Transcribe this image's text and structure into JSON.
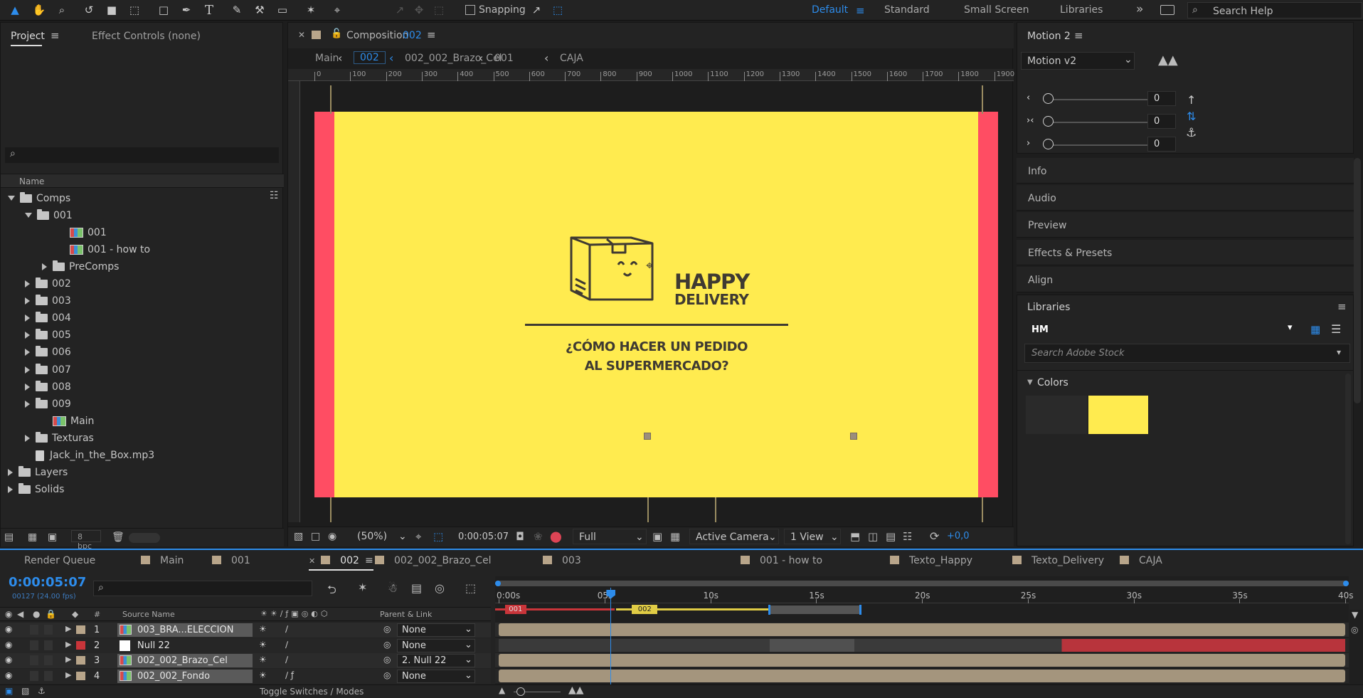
{
  "toolbar": {
    "snapping_label": "Snapping",
    "workspaces": [
      "Default",
      "Standard",
      "Small Screen",
      "Libraries"
    ],
    "search_placeholder": "Search Help",
    "accent": "#2d8ceb"
  },
  "project": {
    "tab_project": "Project",
    "tab_effect": "Effect Controls (none)",
    "column_name": "Name",
    "items": [
      {
        "label": "Comps",
        "type": "folder",
        "depth": 0,
        "expand": "open"
      },
      {
        "label": "001",
        "type": "folder",
        "depth": 1,
        "expand": "open"
      },
      {
        "label": "001",
        "type": "comp",
        "depth": 3,
        "expand": "none"
      },
      {
        "label": "001 - how to",
        "type": "comp",
        "depth": 3,
        "expand": "none"
      },
      {
        "label": "PreComps",
        "type": "folder",
        "depth": 2,
        "expand": "closed"
      },
      {
        "label": "002",
        "type": "folder",
        "depth": 1,
        "expand": "closed"
      },
      {
        "label": "003",
        "type": "folder",
        "depth": 1,
        "expand": "closed"
      },
      {
        "label": "004",
        "type": "folder",
        "depth": 1,
        "expand": "closed"
      },
      {
        "label": "005",
        "type": "folder",
        "depth": 1,
        "expand": "closed"
      },
      {
        "label": "006",
        "type": "folder",
        "depth": 1,
        "expand": "closed"
      },
      {
        "label": "007",
        "type": "folder",
        "depth": 1,
        "expand": "closed"
      },
      {
        "label": "008",
        "type": "folder",
        "depth": 1,
        "expand": "closed"
      },
      {
        "label": "009",
        "type": "folder",
        "depth": 1,
        "expand": "closed"
      },
      {
        "label": "Main",
        "type": "comp",
        "depth": 2,
        "expand": "none"
      },
      {
        "label": "Texturas",
        "type": "folder",
        "depth": 1,
        "expand": "closed"
      },
      {
        "label": "Jack_in_the_Box.mp3",
        "type": "audio",
        "depth": 1,
        "expand": "none"
      },
      {
        "label": "Layers",
        "type": "folder",
        "depth": 0,
        "expand": "closed"
      },
      {
        "label": "Solids",
        "type": "folder",
        "depth": 0,
        "expand": "closed"
      }
    ],
    "bpc": "8 bpc"
  },
  "composition": {
    "tab_prefix": "Composition",
    "tab_name": "002",
    "breadcrumbs": [
      "Main",
      "002",
      "002_002_Brazo_Cel",
      "001",
      "CAJA"
    ],
    "ruler_ticks": [
      "0",
      "100",
      "200",
      "300",
      "400",
      "500",
      "600",
      "700",
      "800",
      "900",
      "1000",
      "1100",
      "1200",
      "1300",
      "1400",
      "1500",
      "1600",
      "1700",
      "1800",
      "1900"
    ],
    "brand_line1": "HAPPY",
    "brand_line2": "DELIVERY",
    "question_line1": "¿CÓMO HACER UN PEDIDO",
    "question_line2": "AL SUPERMERCADO?",
    "bg_color": "#ffeb4f",
    "side_color": "#ff4d63",
    "ink_color": "#3f3a32",
    "zoom": "(50%)",
    "timecode": "0:00:05:07",
    "resolution": "Full",
    "camera": "Active Camera",
    "views": "1 View",
    "exposure": "+0,0"
  },
  "motion": {
    "title": "Motion 2",
    "preset": "Motion v2",
    "slider_values": [
      "0",
      "0",
      "0"
    ]
  },
  "side_panels": [
    "Info",
    "Audio",
    "Preview",
    "Effects & Presets",
    "Align"
  ],
  "libraries": {
    "title": "Libraries",
    "library_name": "HM",
    "search_placeholder": "Search Adobe Stock",
    "colors_label": "Colors",
    "swatches": [
      "#2a2a2a",
      "#ffeb4f"
    ]
  },
  "timeline": {
    "render_queue": "Render Queue",
    "tabs": [
      "Main",
      "001",
      "002",
      "002_002_Brazo_Cel",
      "003",
      "001 - how to",
      "Texto_Happy",
      "Texto_Delivery",
      "CAJA"
    ],
    "active_tab": "002",
    "timecode": "0:00:05:07",
    "frame_info": "00127 (24.00 fps)",
    "col_num": "#",
    "col_source": "Source Name",
    "col_parent": "Parent & Link",
    "ruler": [
      {
        "label": "0:00s",
        "t": 0
      },
      {
        "label": "05s",
        "t": 5
      },
      {
        "label": "10s",
        "t": 10
      },
      {
        "label": "15s",
        "t": 15
      },
      {
        "label": "20s",
        "t": 20
      },
      {
        "label": "25s",
        "t": 25
      },
      {
        "label": "30s",
        "t": 30
      },
      {
        "label": "35s",
        "t": 35
      },
      {
        "label": "40s",
        "t": 40
      }
    ],
    "duration_s": 40,
    "playhead_s": 5.29,
    "markers": [
      {
        "label": "001",
        "start_s": 0.3,
        "end_s": 1.3
      },
      {
        "label": "002",
        "start_s": 6.3,
        "end_s": 7.5
      }
    ],
    "layers": [
      {
        "num": "1",
        "name": "003_BRA...ELECCION",
        "label_color": "#b8a58a",
        "parent": "None"
      },
      {
        "num": "2",
        "name": "Null 22",
        "label_color": "#c9353a",
        "parent": "None"
      },
      {
        "num": "3",
        "name": "002_002_Brazo_Cel",
        "label_color": "#b8a58a",
        "parent": "2. Null 22"
      },
      {
        "num": "4",
        "name": "002_002_Fondo",
        "label_color": "#b8a58a",
        "parent": "None"
      }
    ],
    "toggle_label": "Toggle Switches / Modes"
  }
}
